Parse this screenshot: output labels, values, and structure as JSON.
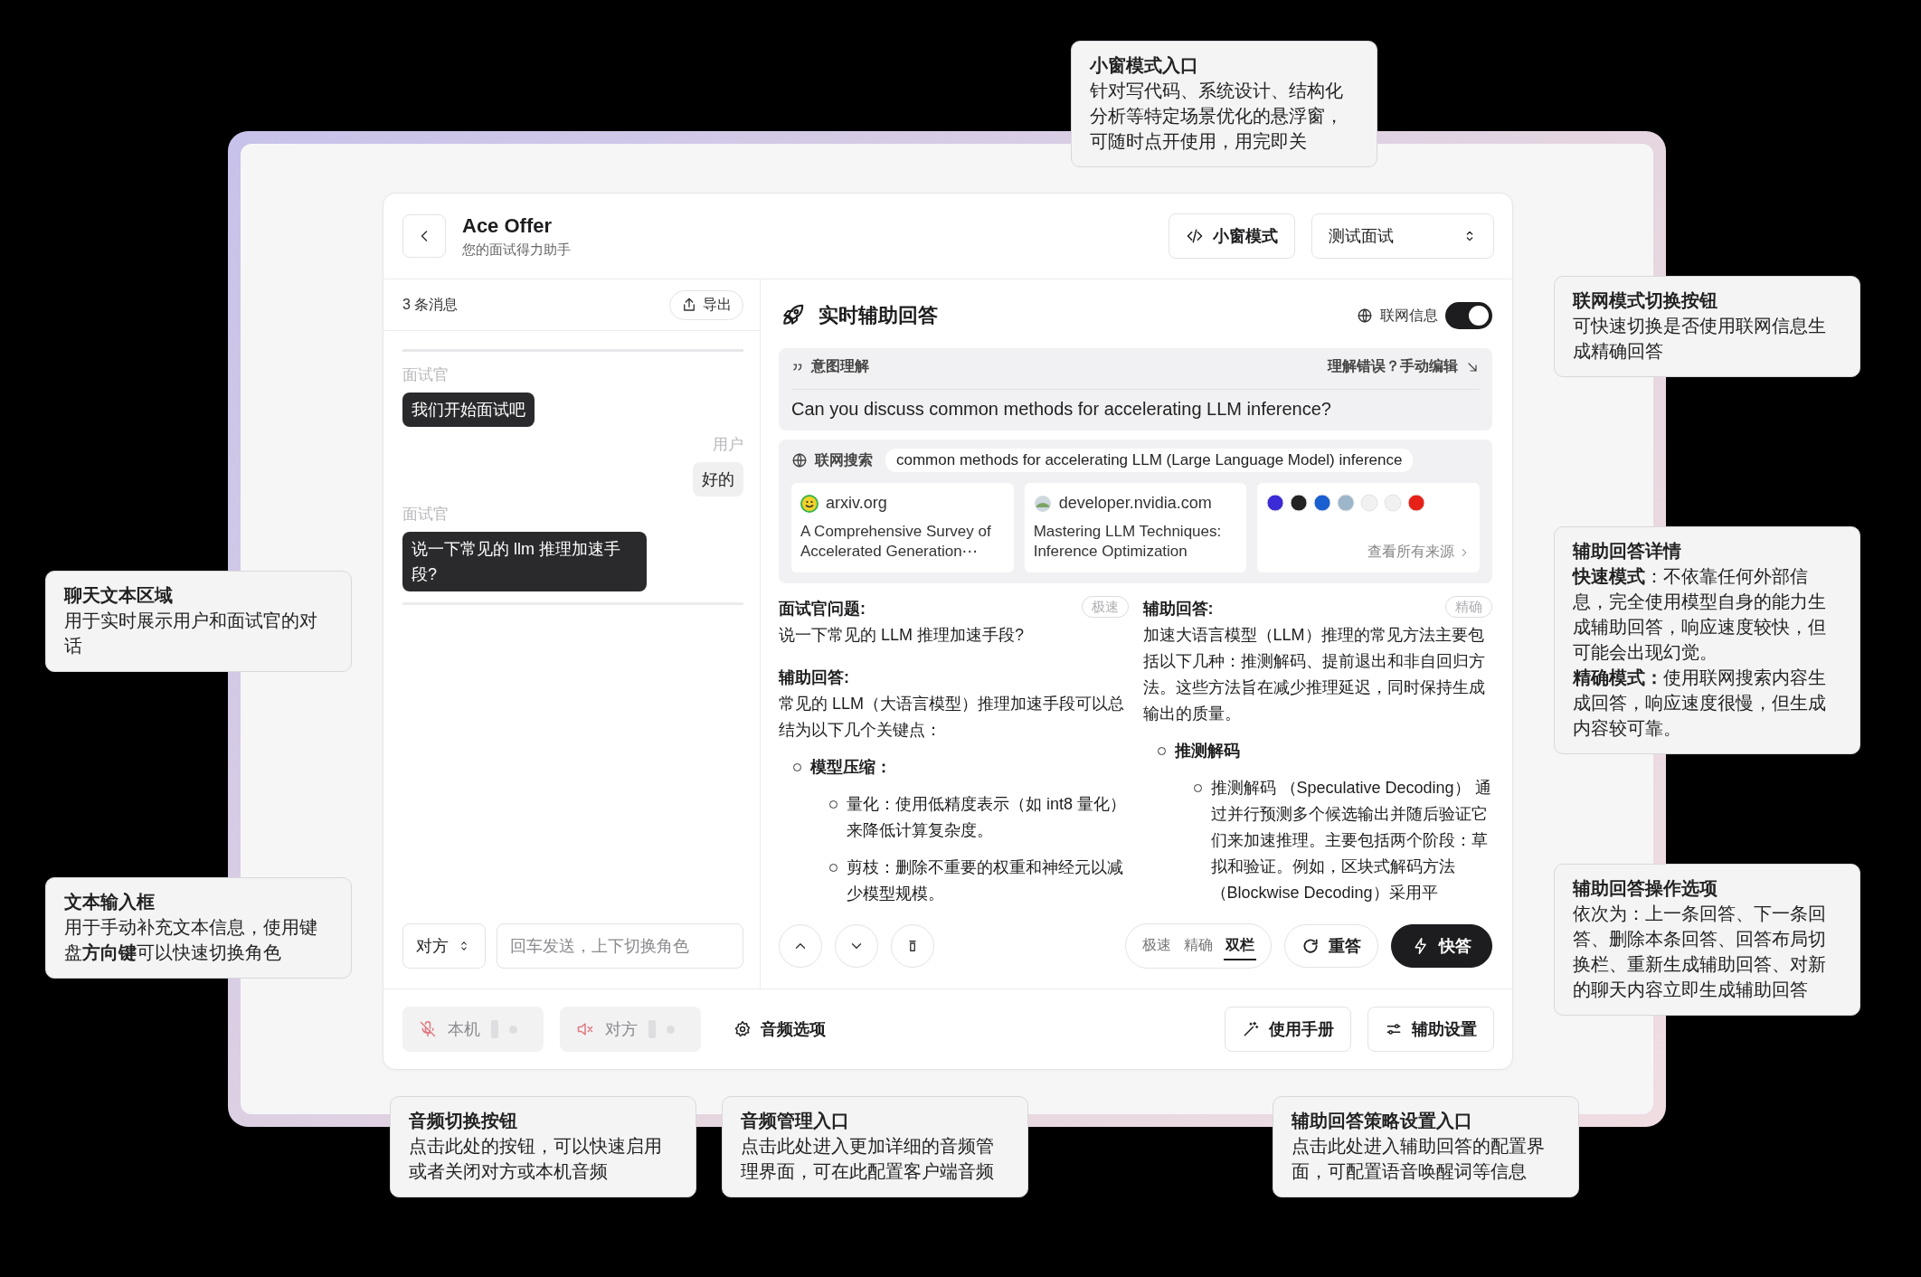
{
  "app": {
    "title": "Ace Offer",
    "subtitle": "您的面试得力助手",
    "mini_mode_button": "小窗模式",
    "mode_select": {
      "value": "测试面试"
    }
  },
  "chat": {
    "count": "3 条消息",
    "export_button": "导出",
    "messages": [
      {
        "kind": "interviewer",
        "speaker": "面试官",
        "text": "我们开始面试吧"
      },
      {
        "kind": "user",
        "speaker": "用户",
        "text": "好的"
      },
      {
        "kind": "interviewer",
        "speaker": "面试官",
        "text": "说一下常见的 llm 推理加速手段?"
      }
    ],
    "role_select": "对方",
    "input": {
      "placeholder": "回车发送，上下切换角色"
    }
  },
  "assist": {
    "title": "实时辅助回答",
    "web_toggle": {
      "label": "联网信息",
      "on": true
    },
    "intent": {
      "label": "意图理解",
      "edit_link": "理解错误？手动编辑",
      "text": "Can you discuss common methods for accelerating LLM inference?"
    },
    "search": {
      "label": "联网搜索",
      "query": "common methods for accelerating LLM (Large Language Model) inference",
      "sources": [
        {
          "site": "arxiv.org",
          "title": "A Comprehensive Survey of Accelerated Generation⋯"
        },
        {
          "site": "developer.nvidia.com",
          "title": "Mastering LLM Techniques: Inference Optimization"
        }
      ],
      "more_link": "查看所有来源"
    },
    "columns": [
      {
        "badge": "极速",
        "blocks": [
          {
            "kind": "heading",
            "text": "面试官问题:"
          },
          {
            "kind": "text",
            "text": "说一下常见的 LLM 推理加速手段?"
          },
          {
            "kind": "heading",
            "text": "辅助回答:"
          },
          {
            "kind": "text",
            "text": "常见的 LLM（大语言模型）推理加速手段可以总结为以下几个关键点："
          },
          {
            "kind": "bullet",
            "text": "模型压缩：",
            "children": [
              {
                "text": "量化：使用低精度表示（如 int8 量化）来降低计算复杂度。"
              },
              {
                "text": "剪枝：删除不重要的权重和神经元以减少模型规模。"
              }
            ]
          }
        ]
      },
      {
        "badge": "精确",
        "blocks": [
          {
            "kind": "heading",
            "text": "辅助回答:"
          },
          {
            "kind": "text",
            "text": "加速大语言模型（LLM）推理的常见方法主要包括以下几种：推测解码、提前退出和非自回归方法。这些方法旨在减少推理延迟，同时保持生成输出的质量。"
          },
          {
            "kind": "bullet",
            "text": "推测解码",
            "children": [
              {
                "text": "推测解码 （Speculative Decoding） 通过并行预测多个候选输出并随后验证它们来加速推理。主要包括两个阶段：草拟和验证。例如，区块式解码方法（Blockwise Decoding）采用平"
              }
            ]
          }
        ]
      }
    ]
  },
  "toolbar": {
    "layout_options": [
      {
        "label": "极速",
        "selected": false
      },
      {
        "label": "精确",
        "selected": false
      },
      {
        "label": "双栏",
        "selected": true
      }
    ],
    "regenerate_button": "重答",
    "quick_button": "快答"
  },
  "bottom_bar": {
    "audio": [
      {
        "kind": "mic",
        "label": "本机",
        "on": false
      },
      {
        "kind": "speaker",
        "label": "对方",
        "on": false
      }
    ],
    "audio_options": "音频选项",
    "manual_button": "使用手册",
    "settings_button": "辅助设置"
  },
  "callouts": [
    {
      "title": "小窗模式入口",
      "body": [
        "针对写代码、系统设计、结构化分析等特定场景优化的悬浮窗，可随时点开使用，用完即关"
      ]
    },
    {
      "title": "联网模式切换按钮",
      "body": [
        "可快速切换是否使用联网信息生成精确回答"
      ]
    },
    {
      "title": "辅助回答详情",
      "body": [
        "**快速模式**：不依靠任何外部信息，完全使用模型自身的能力生成辅助回答，响应速度较快，但可能会出现幻觉。",
        "**精确模式：**使用联网搜索内容生成回答，响应速度很慢，但生成内容较可靠。"
      ]
    },
    {
      "title": "聊天文本区域",
      "body": [
        "用于实时展示用户和面试官的对话"
      ]
    },
    {
      "title": "辅助回答操作选项",
      "body": [
        "依次为：上一条回答、下一条回答、删除本条回答、回答布局切换栏、重新生成辅助回答、对新的聊天内容立即生成辅助回答"
      ]
    },
    {
      "title": "文本输入框",
      "body": [
        "用于手动补充文本信息，使用键盘**方向键**可以快速切换角色"
      ]
    },
    {
      "title": "音频切换按钮",
      "body": [
        "点击此处的按钮，可以快速启用或者关闭对方或本机音频"
      ]
    },
    {
      "title": "音频管理入口",
      "body": [
        "点击此处进入更加详细的音频管理界面，可在此配置客户端音频"
      ]
    },
    {
      "title": "辅助回答策略设置入口",
      "body": [
        "点击此处进入辅助回答的配置界面，可配置语音唤醒词等信息"
      ]
    }
  ]
}
